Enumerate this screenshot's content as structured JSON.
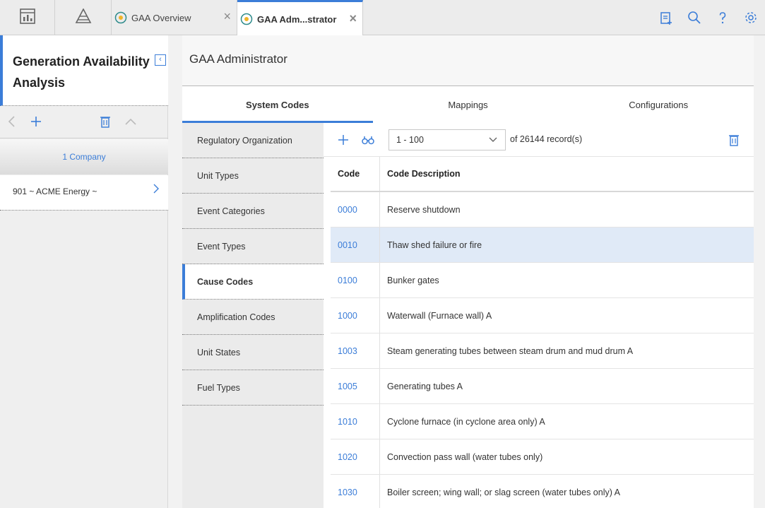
{
  "topbar": {
    "tabs": [
      {
        "label": "GAA Overview"
      },
      {
        "label": "GAA Adm...strator"
      }
    ],
    "close_glyph": "×"
  },
  "left_panel": {
    "title": "Generation Availability Analysis",
    "collapse_glyph": "‹",
    "count_label": "1 Company",
    "items": [
      {
        "label": "901 ~ ACME Energy ~"
      }
    ]
  },
  "main": {
    "title": "GAA Administrator",
    "tabs": [
      "System Codes",
      "Mappings",
      "Configurations"
    ],
    "selected_tab": "System Codes",
    "nav_items": [
      "Regulatory Organization",
      "Unit Types",
      "Event Categories",
      "Event Types",
      "Cause Codes",
      "Amplification Codes",
      "Unit States",
      "Fuel Types"
    ],
    "selected_nav": "Cause Codes",
    "pager": {
      "range": "1 - 100",
      "records_text": "of 26144 record(s)"
    },
    "table": {
      "columns": [
        "Code",
        "Code Description"
      ],
      "rows": [
        {
          "code": "0000",
          "desc": "Reserve shutdown"
        },
        {
          "code": "0010",
          "desc": "Thaw shed failure or fire"
        },
        {
          "code": "0100",
          "desc": "Bunker gates"
        },
        {
          "code": "1000",
          "desc": "Waterwall (Furnace wall) A"
        },
        {
          "code": "1003",
          "desc": "Steam generating tubes between steam drum and mud drum A"
        },
        {
          "code": "1005",
          "desc": "Generating tubes A"
        },
        {
          "code": "1010",
          "desc": "Cyclone furnace (in cyclone area only) A"
        },
        {
          "code": "1020",
          "desc": "Convection pass wall (water tubes only)"
        },
        {
          "code": "1030",
          "desc": "Boiler screen; wing wall; or slag screen (water tubes only) A"
        }
      ],
      "highlighted_row": "0010"
    }
  },
  "colors": {
    "accent": "#3b7dd8",
    "highlight": "#e0eaf7"
  }
}
